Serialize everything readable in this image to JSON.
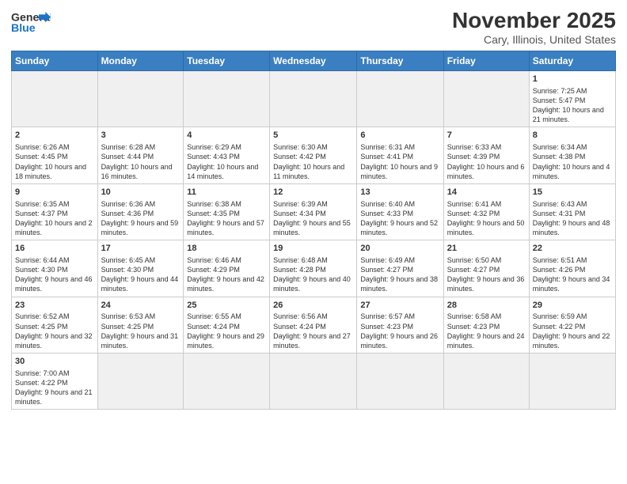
{
  "logo": {
    "text_general": "General",
    "text_blue": "Blue"
  },
  "header": {
    "month": "November 2025",
    "location": "Cary, Illinois, United States"
  },
  "weekdays": [
    "Sunday",
    "Monday",
    "Tuesday",
    "Wednesday",
    "Thursday",
    "Friday",
    "Saturday"
  ],
  "weeks": [
    [
      {
        "day": "",
        "info": ""
      },
      {
        "day": "",
        "info": ""
      },
      {
        "day": "",
        "info": ""
      },
      {
        "day": "",
        "info": ""
      },
      {
        "day": "",
        "info": ""
      },
      {
        "day": "",
        "info": ""
      },
      {
        "day": "1",
        "info": "Sunrise: 7:25 AM\nSunset: 5:47 PM\nDaylight: 10 hours and 21 minutes."
      }
    ],
    [
      {
        "day": "2",
        "info": "Sunrise: 6:26 AM\nSunset: 4:45 PM\nDaylight: 10 hours and 18 minutes."
      },
      {
        "day": "3",
        "info": "Sunrise: 6:28 AM\nSunset: 4:44 PM\nDaylight: 10 hours and 16 minutes."
      },
      {
        "day": "4",
        "info": "Sunrise: 6:29 AM\nSunset: 4:43 PM\nDaylight: 10 hours and 14 minutes."
      },
      {
        "day": "5",
        "info": "Sunrise: 6:30 AM\nSunset: 4:42 PM\nDaylight: 10 hours and 11 minutes."
      },
      {
        "day": "6",
        "info": "Sunrise: 6:31 AM\nSunset: 4:41 PM\nDaylight: 10 hours and 9 minutes."
      },
      {
        "day": "7",
        "info": "Sunrise: 6:33 AM\nSunset: 4:39 PM\nDaylight: 10 hours and 6 minutes."
      },
      {
        "day": "8",
        "info": "Sunrise: 6:34 AM\nSunset: 4:38 PM\nDaylight: 10 hours and 4 minutes."
      }
    ],
    [
      {
        "day": "9",
        "info": "Sunrise: 6:35 AM\nSunset: 4:37 PM\nDaylight: 10 hours and 2 minutes."
      },
      {
        "day": "10",
        "info": "Sunrise: 6:36 AM\nSunset: 4:36 PM\nDaylight: 9 hours and 59 minutes."
      },
      {
        "day": "11",
        "info": "Sunrise: 6:38 AM\nSunset: 4:35 PM\nDaylight: 9 hours and 57 minutes."
      },
      {
        "day": "12",
        "info": "Sunrise: 6:39 AM\nSunset: 4:34 PM\nDaylight: 9 hours and 55 minutes."
      },
      {
        "day": "13",
        "info": "Sunrise: 6:40 AM\nSunset: 4:33 PM\nDaylight: 9 hours and 52 minutes."
      },
      {
        "day": "14",
        "info": "Sunrise: 6:41 AM\nSunset: 4:32 PM\nDaylight: 9 hours and 50 minutes."
      },
      {
        "day": "15",
        "info": "Sunrise: 6:43 AM\nSunset: 4:31 PM\nDaylight: 9 hours and 48 minutes."
      }
    ],
    [
      {
        "day": "16",
        "info": "Sunrise: 6:44 AM\nSunset: 4:30 PM\nDaylight: 9 hours and 46 minutes."
      },
      {
        "day": "17",
        "info": "Sunrise: 6:45 AM\nSunset: 4:30 PM\nDaylight: 9 hours and 44 minutes."
      },
      {
        "day": "18",
        "info": "Sunrise: 6:46 AM\nSunset: 4:29 PM\nDaylight: 9 hours and 42 minutes."
      },
      {
        "day": "19",
        "info": "Sunrise: 6:48 AM\nSunset: 4:28 PM\nDaylight: 9 hours and 40 minutes."
      },
      {
        "day": "20",
        "info": "Sunrise: 6:49 AM\nSunset: 4:27 PM\nDaylight: 9 hours and 38 minutes."
      },
      {
        "day": "21",
        "info": "Sunrise: 6:50 AM\nSunset: 4:27 PM\nDaylight: 9 hours and 36 minutes."
      },
      {
        "day": "22",
        "info": "Sunrise: 6:51 AM\nSunset: 4:26 PM\nDaylight: 9 hours and 34 minutes."
      }
    ],
    [
      {
        "day": "23",
        "info": "Sunrise: 6:52 AM\nSunset: 4:25 PM\nDaylight: 9 hours and 32 minutes."
      },
      {
        "day": "24",
        "info": "Sunrise: 6:53 AM\nSunset: 4:25 PM\nDaylight: 9 hours and 31 minutes."
      },
      {
        "day": "25",
        "info": "Sunrise: 6:55 AM\nSunset: 4:24 PM\nDaylight: 9 hours and 29 minutes."
      },
      {
        "day": "26",
        "info": "Sunrise: 6:56 AM\nSunset: 4:24 PM\nDaylight: 9 hours and 27 minutes."
      },
      {
        "day": "27",
        "info": "Sunrise: 6:57 AM\nSunset: 4:23 PM\nDaylight: 9 hours and 26 minutes."
      },
      {
        "day": "28",
        "info": "Sunrise: 6:58 AM\nSunset: 4:23 PM\nDaylight: 9 hours and 24 minutes."
      },
      {
        "day": "29",
        "info": "Sunrise: 6:59 AM\nSunset: 4:22 PM\nDaylight: 9 hours and 22 minutes."
      }
    ],
    [
      {
        "day": "30",
        "info": "Sunrise: 7:00 AM\nSunset: 4:22 PM\nDaylight: 9 hours and 21 minutes."
      },
      {
        "day": "",
        "info": ""
      },
      {
        "day": "",
        "info": ""
      },
      {
        "day": "",
        "info": ""
      },
      {
        "day": "",
        "info": ""
      },
      {
        "day": "",
        "info": ""
      },
      {
        "day": "",
        "info": ""
      }
    ]
  ]
}
